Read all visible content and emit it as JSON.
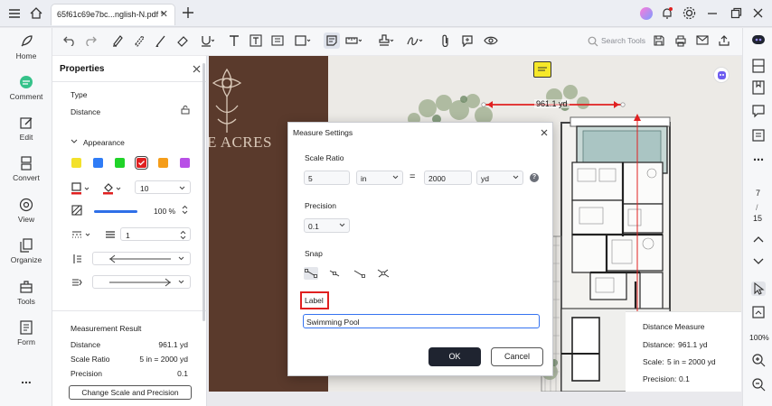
{
  "titlebar": {
    "tab_title": "65f61c69e7bc...nglish-N.pdf *",
    "colors": {
      "accent": "#3573f0",
      "highlight_red": "#e02020"
    }
  },
  "toolbar": {
    "search_placeholder": "Search Tools"
  },
  "rail": {
    "items": [
      {
        "label": "Home",
        "icon": "rocket-icon"
      },
      {
        "label": "Comment",
        "icon": "comment-icon"
      },
      {
        "label": "Edit",
        "icon": "edit-icon"
      },
      {
        "label": "Convert",
        "icon": "convert-icon"
      },
      {
        "label": "View",
        "icon": "eye-icon"
      },
      {
        "label": "Organize",
        "icon": "organize-icon"
      },
      {
        "label": "Tools",
        "icon": "toolbox-icon"
      },
      {
        "label": "Form",
        "icon": "form-icon"
      }
    ],
    "more": "..."
  },
  "properties": {
    "title": "Properties",
    "type_label": "Type",
    "type_value": "Distance",
    "appearance_label": "Appearance",
    "swatches": [
      "#f3e12b",
      "#2f7cf6",
      "#20d329",
      "#e02020",
      "#f59d1a",
      "#b84fe6"
    ],
    "stroke_color": "#e02020",
    "line_width": "10",
    "opacity": "100 %",
    "dash_value": "1",
    "measurement_result_label": "Measurement Result",
    "distance_label": "Distance",
    "distance_value": "961.1 yd",
    "scale_ratio_label": "Scale Ratio",
    "scale_ratio_value": "5 in = 2000 yd",
    "precision_label": "Precision",
    "precision_value": "0.1",
    "change_button": "Change Scale and Precision"
  },
  "document": {
    "brand_text": "E ACRES",
    "measure_label": "961.1 yd"
  },
  "dialog": {
    "title": "Measure Settings",
    "scale_ratio_label": "Scale Ratio",
    "scale_from_value": "5",
    "scale_from_unit": "in",
    "equals": "=",
    "scale_to_value": "2000",
    "scale_to_unit": "yd",
    "precision_label": "Precision",
    "precision_value": "0.1",
    "snap_label": "Snap",
    "label_label": "Label",
    "label_value": "Swimming Pool",
    "ok_button": "OK",
    "cancel_button": "Cancel"
  },
  "distance_measure": {
    "title": "Distance Measure",
    "distance_label": "Distance:",
    "distance_value": "961.1 yd",
    "scale_label": "Scale:",
    "scale_value": "5 in = 2000 yd",
    "precision_label": "Precision:",
    "precision_value": "0.1"
  },
  "right_rail": {
    "page_number": "7",
    "page_total": "15",
    "zoom": "100%"
  }
}
